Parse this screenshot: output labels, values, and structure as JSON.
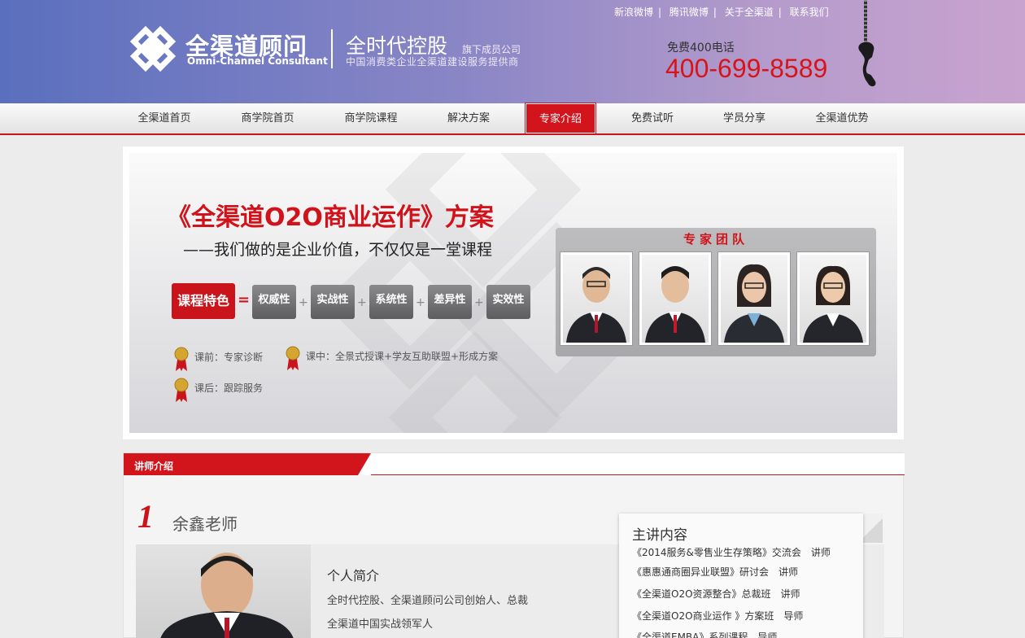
{
  "header": {
    "logo_cn": "全渠道顾问",
    "logo_en": "Omni-Channel Consultant",
    "brand2": "全时代控股",
    "brand2_sub": "旗下成员公司",
    "brand2_desc": "中国消费类企业全渠道建设服务提供商",
    "top_links": [
      "新浪微博",
      "腾讯微博",
      "关于全渠道",
      "联系我们"
    ],
    "hotline_label": "免费400电话",
    "hotline": "400-699-8589"
  },
  "nav": {
    "items": [
      "全渠道首页",
      "商学院首页",
      "商学院课程",
      "解决方案",
      "专家介绍",
      "免费试听",
      "学员分享",
      "全渠道优势"
    ],
    "active_index": 4
  },
  "banner": {
    "title": "《全渠道O2O商业运作》方案",
    "subtitle": "——我们做的是企业价值，不仅仅是一堂课程",
    "feature_main": "课程特色",
    "eq": "=",
    "plus": "+",
    "features": [
      "权威性",
      "实战性",
      "系统性",
      "差异性",
      "实效性"
    ],
    "steps": [
      "课前：专家诊断",
      "课中：全景式授课+学友互助联盟+形成方案",
      "课后：跟踪服务"
    ],
    "team_title": "专家团队"
  },
  "section": {
    "title": "讲师介绍",
    "teacher_num": "1",
    "teacher_name": "余鑫老师",
    "intro_heading": "个人简介",
    "intro_lines": [
      "全时代控股、全渠道顾问公司创始人、总裁",
      "全渠道中国实战领军人"
    ],
    "topics_heading": "主讲内容",
    "topics": [
      "《2014服务&零售业生存策略》交流会　讲师",
      "《惠惠通商圈异业联盟》研讨会　讲师",
      "《全渠道O2O资源整合》总裁班　讲师",
      "《全渠道O2O商业运作 》方案班　导师",
      "《全渠道EMBA》系列课程　导师"
    ]
  },
  "colors": {
    "brand_red": "#d2151d",
    "header_start": "#5a6fbe",
    "header_end": "#c9a3cf"
  }
}
